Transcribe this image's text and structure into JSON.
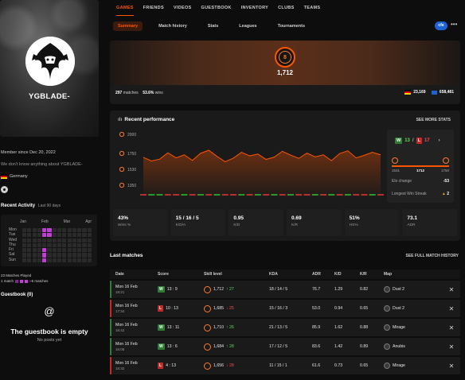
{
  "profile": {
    "nickname": "YGBLADE-",
    "member_since": "Member since Dec 20, 2022",
    "about": "We don't know anything about YGBLADE-",
    "country": "Germany"
  },
  "activity": {
    "title": "Recent Activity",
    "subtitle": "Last 90 days",
    "months": [
      "Jan",
      "Feb",
      "Mar",
      "Apr"
    ],
    "days": [
      "Mon",
      "Tue",
      "Wed",
      "Thu",
      "Fri",
      "Sat",
      "Sun"
    ],
    "active_cells": [
      [
        0,
        4
      ],
      [
        0,
        5
      ],
      [
        1,
        4
      ],
      [
        1,
        5
      ],
      [
        4,
        4
      ],
      [
        5,
        4
      ],
      [
        6,
        4
      ]
    ],
    "matches_played": "23 Matches Played",
    "legend_left": "1 match",
    "legend_right": "~5 matches"
  },
  "guestbook": {
    "title": "Guestbook (0)",
    "empty": "The guestbook is empty",
    "none": "No posts yet"
  },
  "topnav": [
    "GAMES",
    "FRIENDS",
    "VIDEOS",
    "GUESTBOOK",
    "INVENTORY",
    "CLUBS",
    "TEAMS"
  ],
  "subnav": [
    "Summary",
    "Match history",
    "Stats",
    "Leagues",
    "Tournaments"
  ],
  "fc_badge": "cfe",
  "summary": {
    "level": "8",
    "elo": "1,712",
    "matches": "297",
    "matches_label": "matches",
    "winrate": "53.6%",
    "winrate_label": "wins",
    "country_rank": "23,169",
    "region_rank": "658,481"
  },
  "performance": {
    "title": "Recent performance",
    "see_more": "SEE MORE STATS",
    "y_ticks": [
      "2000",
      "1750",
      "1530",
      "1350"
    ],
    "last_panel": {
      "wins": "13",
      "losses": "17",
      "bar_min": "1531",
      "bar_cur": "1712",
      "bar_max": "1750",
      "elo_change_label": "Elo change",
      "elo_change": "-53",
      "streak_label": "Longest Win Streak",
      "streak": "2"
    },
    "kpis": [
      {
        "value": "43%",
        "label": "Wins %"
      },
      {
        "value": "15 / 16 / 5",
        "label": "K/D/A"
      },
      {
        "value": "0.95",
        "label": "K/D"
      },
      {
        "value": "0.69",
        "label": "K/R"
      },
      {
        "value": "51%",
        "label": "HS%"
      },
      {
        "value": "73.1",
        "label": "ADR"
      }
    ]
  },
  "chart_data": {
    "type": "line",
    "values": [
      1702,
      1688,
      1695,
      1720,
      1700,
      1712,
      1690,
      1718,
      1730,
      1706,
      1685,
      1699,
      1722,
      1708,
      1715,
      1694,
      1703,
      1726,
      1711,
      1698,
      1719,
      1704,
      1712,
      1689,
      1717,
      1728,
      1700,
      1710,
      1722,
      1712
    ],
    "results": [
      "L",
      "W",
      "W",
      "L",
      "L",
      "W",
      "L",
      "W",
      "L",
      "W",
      "L",
      "L",
      "W",
      "L",
      "W",
      "L",
      "W",
      "L",
      "W",
      "L",
      "L",
      "W",
      "L",
      "W",
      "L",
      "W",
      "L",
      "L",
      "W",
      "L"
    ],
    "ylim": [
      1350,
      2000
    ]
  },
  "last_matches": {
    "title": "Last matches",
    "see_full": "SEE FULL MATCH HISTORY",
    "headers": [
      "Date",
      "Score",
      "Skill level",
      "KDA",
      "ADR",
      "K/D",
      "K/R",
      "Map"
    ],
    "rows": [
      {
        "date": "Mon 16 Feb",
        "time": "18:21",
        "result": "W",
        "score": "13 : 9",
        "elo": "1,712",
        "delta": "↑ 27",
        "kda": "18 / 14 / 5",
        "adr": "76.7",
        "kd": "1.29",
        "kr": "0.82",
        "map": "Dust 2"
      },
      {
        "date": "Mon 16 Feb",
        "time": "17:34",
        "result": "L",
        "score": "10 : 13",
        "elo": "1,685",
        "delta": "↓ 25",
        "kda": "15 / 16 / 3",
        "adr": "53.0",
        "kd": "0.94",
        "kr": "0.65",
        "map": "Dust 2"
      },
      {
        "date": "Mon 16 Feb",
        "time": "16:42",
        "result": "W",
        "score": "13 : 11",
        "elo": "1,710",
        "delta": "↑ 26",
        "kda": "21 / 13 / 5",
        "adr": "85.9",
        "kd": "1.62",
        "kr": "0.88",
        "map": "Mirage"
      },
      {
        "date": "Mon 16 Feb",
        "time": "16:06",
        "result": "W",
        "score": "13 : 6",
        "elo": "1,684",
        "delta": "↑ 28",
        "kda": "17 / 12 / 5",
        "adr": "83.6",
        "kd": "1.42",
        "kr": "0.89",
        "map": "Anubis"
      },
      {
        "date": "Mon 16 Feb",
        "time": "15:32",
        "result": "L",
        "score": "4 : 13",
        "elo": "1,656",
        "delta": "↓ 28",
        "kda": "11 / 15 / 1",
        "adr": "61.6",
        "kd": "0.73",
        "kr": "0.65",
        "map": "Mirage"
      }
    ]
  }
}
